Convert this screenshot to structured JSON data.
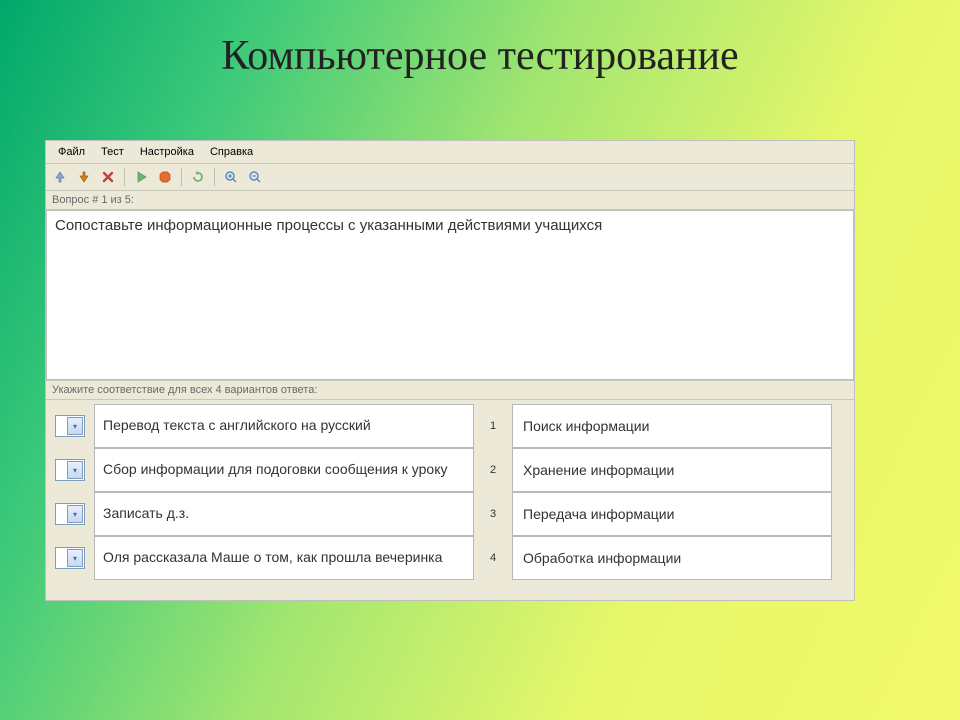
{
  "slide": {
    "title": "Компьютерное тестирование"
  },
  "menubar": {
    "file": "Файл",
    "test": "Тест",
    "settings": "Настройка",
    "help": "Справка"
  },
  "toolbar_icons": {
    "up": "arrow-up-icon",
    "down": "arrow-down-icon",
    "stop": "x-cancel-icon",
    "play": "play-icon",
    "stop_hex": "stop-hex-icon",
    "refresh": "refresh-icon",
    "zoom_in": "zoom-in-icon",
    "zoom_out": "zoom-out-icon"
  },
  "status": {
    "question_counter": "Вопрос # 1 из 5:"
  },
  "question": {
    "text": "Сопоставьте информационные процессы с указанными действиями учащихся"
  },
  "instruction": {
    "text": "Укажите соответствие для всех 4 вариантов ответа:"
  },
  "match": {
    "rows": [
      {
        "left": "Перевод текста с английского на русский",
        "num": "1",
        "right": "Поиск информации"
      },
      {
        "left": "Сбор информации для подоговки сообщения к уроку",
        "num": "2",
        "right": "Хранение информации"
      },
      {
        "left": "Записать д.з.",
        "num": "3",
        "right": "Передача информации"
      },
      {
        "left": "Оля рассказала Маше о том, как прошла вечеринка",
        "num": "4",
        "right": "Обработка информации"
      }
    ]
  }
}
